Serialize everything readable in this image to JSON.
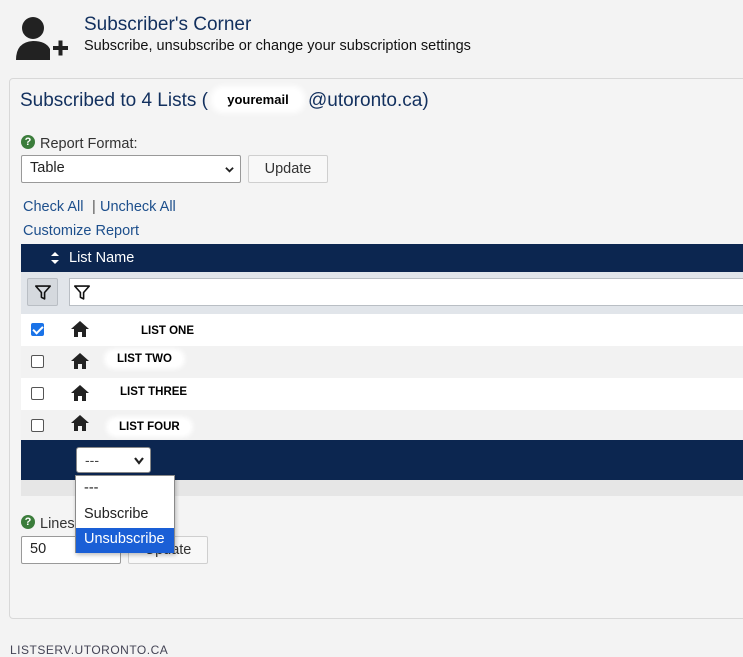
{
  "header": {
    "title": "Subscriber's Corner",
    "subtitle": "Subscribe, unsubscribe or change your subscription settings"
  },
  "panel": {
    "title_prefix": "Subscribed to 4 Lists (",
    "email_user": "youremail",
    "title_suffix": "@utoronto.ca)"
  },
  "report_format": {
    "help": "?",
    "label": "Report Format:",
    "value": "Table",
    "update_label": "Update"
  },
  "links": {
    "check_all": "Check All",
    "separator": "|",
    "uncheck_all": "Uncheck All",
    "customize": "Customize Report"
  },
  "table": {
    "column_header": "List Name",
    "rows": [
      {
        "name": "LIST ONE",
        "checked": true
      },
      {
        "name": "LIST TWO",
        "checked": false
      },
      {
        "name": "LIST THREE",
        "checked": false
      },
      {
        "name": "LIST FOUR",
        "checked": false
      }
    ],
    "action_select_value": "---"
  },
  "dropdown": {
    "options": [
      "---",
      "Subscribe",
      "Unsubscribe"
    ],
    "highlighted": "Unsubscribe"
  },
  "lines": {
    "help": "?",
    "label": "Lines",
    "value": "50",
    "update_label": "Update"
  },
  "footer": {
    "text": "LISTSERV.UTORONTO.CA"
  },
  "colors": {
    "navy": "#0c2650",
    "title_blue": "#12305e",
    "link_blue": "#1d4f8c",
    "selection_blue": "#1a5fd6",
    "help_green": "#3b7d3b"
  }
}
